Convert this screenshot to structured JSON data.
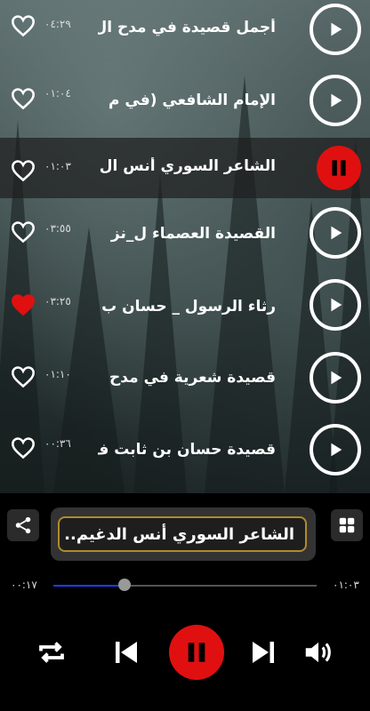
{
  "tracks": [
    {
      "title": "أجمل قصيدة في مدح ال",
      "duration": "٠٤:٢٩",
      "favorite": false,
      "playing": false
    },
    {
      "title": "الإمام الشافعي (في م",
      "duration": "٠١:٠٤",
      "favorite": false,
      "playing": false
    },
    {
      "title": "الشاعر السوري أنس ال",
      "duration": "٠١:٠٣",
      "favorite": false,
      "playing": true
    },
    {
      "title": "القصيدة العصماء ل_نز",
      "duration": "٠٣:٥٥",
      "favorite": false,
      "playing": false
    },
    {
      "title": "رثاء الرسول _ حسان ب",
      "duration": "٠٣:٢٥",
      "favorite": true,
      "playing": false
    },
    {
      "title": "قصيدة  شعرية في مدح",
      "duration": "٠١:١٠",
      "favorite": false,
      "playing": false
    },
    {
      "title": "قصيدة حسان بن ثابت ف",
      "duration": "٠٠:٣٦",
      "favorite": false,
      "playing": false
    }
  ],
  "player": {
    "now_playing": "الشاعر السوري أنس الدغيم..",
    "elapsed": "٠٠:١٧",
    "total": "٠١:٠٣",
    "progress_fraction": 0.27
  },
  "icons": {
    "share": "share-icon",
    "grid": "grid-icon",
    "repeat": "repeat-icon",
    "previous": "skip-previous-icon",
    "pause": "pause-icon",
    "next": "skip-next-icon",
    "volume": "volume-icon",
    "play": "play-icon",
    "heart": "heart-icon"
  },
  "colors": {
    "accent_red": "#e01010",
    "seek_fill": "#1f3cff",
    "favorite_red": "#e01010",
    "now_playing_border": "#b08a2c"
  }
}
